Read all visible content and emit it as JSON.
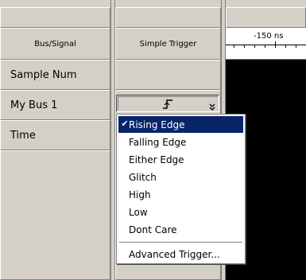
{
  "grid": {
    "header_col1": "Bus/Signal",
    "header_col2": "Simple Trigger",
    "timescale_label": "-150 ns",
    "rows": [
      {
        "label": "Sample Num"
      },
      {
        "label": "My Bus 1"
      },
      {
        "label": "Time"
      }
    ]
  },
  "trigger_select": {
    "icon": "rising-edge-icon",
    "arrow_icon": "double-chevron-down-icon"
  },
  "dropdown": {
    "check_glyph": "✔",
    "items": [
      {
        "label": "Rising Edge",
        "selected": true
      },
      {
        "label": "Falling Edge"
      },
      {
        "label": "Either Edge"
      },
      {
        "label": "Glitch"
      },
      {
        "label": "High"
      },
      {
        "label": "Low"
      },
      {
        "label": "Dont Care"
      }
    ],
    "advanced_label": "Advanced Trigger..."
  },
  "colors": {
    "face": "#d4d0c8",
    "highlight": "#0a246a",
    "waveform_bg": "#000000"
  }
}
